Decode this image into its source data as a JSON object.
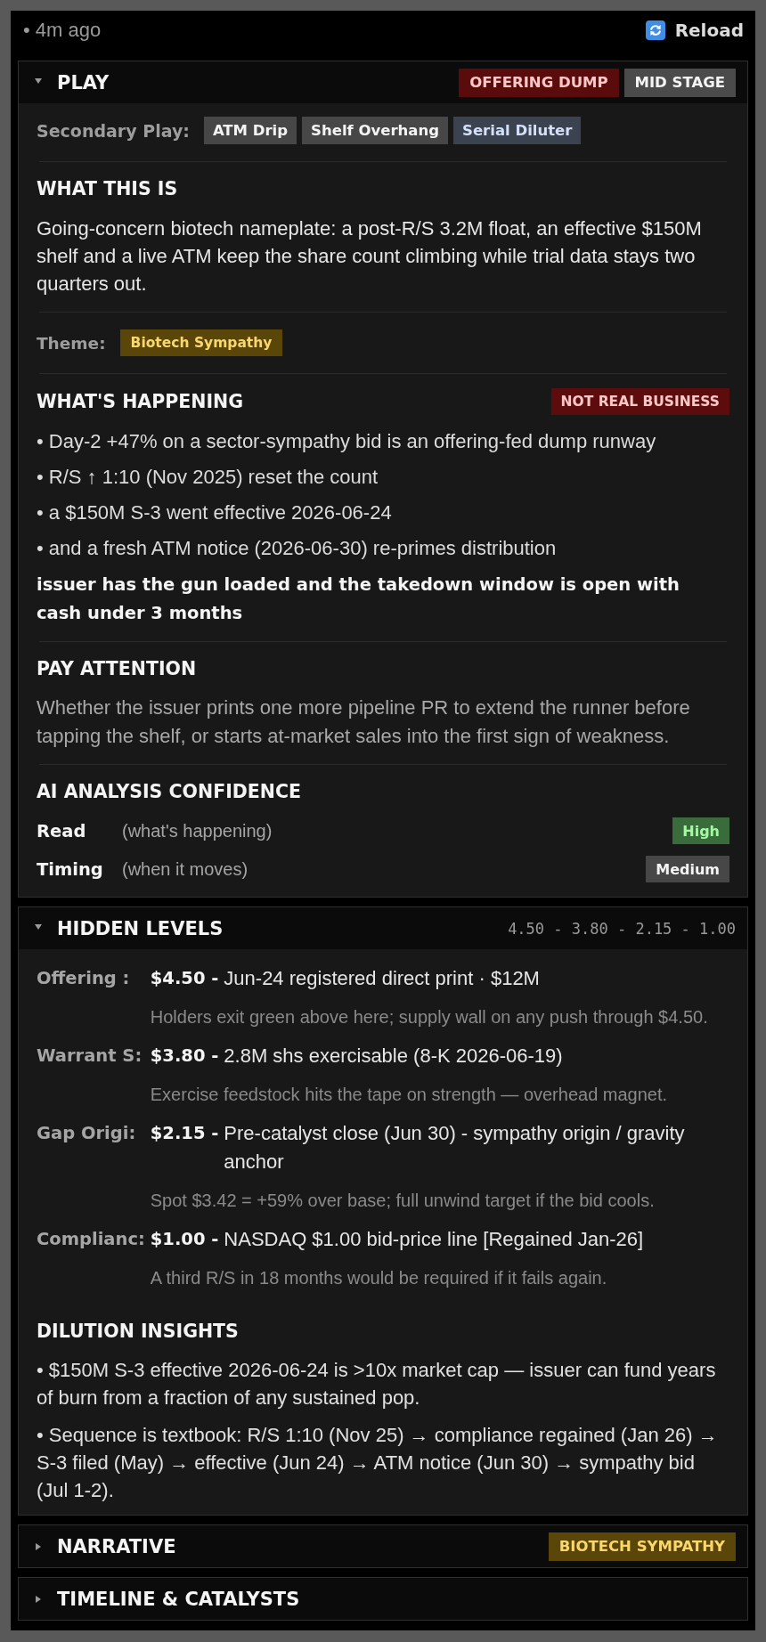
{
  "header": {
    "updated": "• 4m ago",
    "reload": "Reload"
  },
  "sections": [
    {
      "kind": "play",
      "title": "PLAY",
      "expanded": true,
      "badges": [
        {
          "label": "OFFERING DUMP",
          "color": "#5a0b0b"
        },
        {
          "label": "MID STAGE",
          "color": "#4b4b4b"
        }
      ],
      "secondary_play": {
        "label": "Secondary Play:",
        "tags": [
          {
            "label": "ATM Drip",
            "color": "#474747"
          },
          {
            "label": "Shelf Overhang",
            "color": "#474747"
          },
          {
            "label": "Serial Diluter",
            "color": "#3b4250"
          }
        ]
      },
      "what_this_is": {
        "heading": "WHAT THIS IS",
        "text": "Going-concern biotech nameplate: a post-R/S 3.2M float, an effective $150M shelf and a live ATM keep the share count climbing while trial data stays two quarters out."
      },
      "theme": {
        "label": "Theme:",
        "tag": {
          "label": "Biotech Sympathy",
          "color": "#5a4608"
        }
      },
      "whats_happening": {
        "heading": "WHAT'S HAPPENING",
        "badge": {
          "label": "NOT REAL BUSINESS",
          "color": "#5c0c0c"
        },
        "bullets": [
          "• Day-2 +47% on a sector-sympathy bid is an offering-fed dump runway",
          "• R/S ↑ 1:10 (Nov 2025) reset the count",
          "• a $150M S-3 went effective 2026-06-24",
          "• and a fresh ATM notice (2026-06-30) re-primes distribution"
        ],
        "conclusion": "issuer has the gun loaded and the takedown window is open with cash under 3 months"
      },
      "pay_attention": {
        "heading": "PAY ATTENTION",
        "text": "Whether the issuer prints one more pipeline PR to extend the runner before tapping the shelf, or starts at-market sales into the first sign of weakness."
      },
      "confidence": {
        "heading": "AI ANALYSIS CONFIDENCE",
        "rows": [
          {
            "label": "Read",
            "hint": "(what's happening)",
            "value": "High",
            "color": "#3a6b3a"
          },
          {
            "label": "Timing",
            "hint": "(when it moves)",
            "value": "Medium",
            "color": "#474747"
          }
        ]
      }
    },
    {
      "kind": "levels",
      "title": "HIDDEN LEVELS",
      "expanded": true,
      "summary": "4.50 - 3.80 - 2.15 - 1.00",
      "levels": [
        {
          "label": "Offering :",
          "price": "$4.50 -",
          "description": "Jun-24 registered direct print · $12M",
          "note": "Holders exit green above here; supply wall on any push through $4.50."
        },
        {
          "label": "Warrant S:",
          "price": "$3.80 -",
          "description": "2.8M shs exercisable (8-K 2026-06-19)",
          "note": "Exercise feedstock hits the tape on strength — overhead magnet."
        },
        {
          "label": "Gap Origi:",
          "price": "$2.15 -",
          "description": "Pre-catalyst close (Jun 30) - sympathy origin / gravity anchor",
          "note": "Spot $3.42 = +59% over base; full unwind target if the bid cools."
        },
        {
          "label": "Complianc:",
          "price": "$1.00 -",
          "description": "NASDAQ $1.00 bid-price line [Regained Jan-26]",
          "note": "A third R/S in 18 months would be required if it fails again."
        }
      ],
      "dilution_insights": {
        "heading": "DILUTION INSIGHTS",
        "bullets": [
          "• $150M S-3 effective 2026-06-24 is >10x market cap — issuer can fund years of burn from a fraction of any sustained pop.",
          "• Sequence is textbook: R/S 1:10 (Nov 25) → compliance regained (Jan 26) → S-3 filed (May) → effective (Jun 24) → ATM notice (Jun 30) → sympathy bid (Jul 1-2)."
        ]
      }
    },
    {
      "kind": "narrative",
      "title": "NARRATIVE",
      "expanded": false,
      "badges": [
        {
          "label": "BIOTECH SYMPATHY",
          "color": "#5a4608"
        }
      ]
    },
    {
      "kind": "timeline",
      "title": "TIMELINE & CATALYSTS",
      "expanded": false
    }
  ]
}
